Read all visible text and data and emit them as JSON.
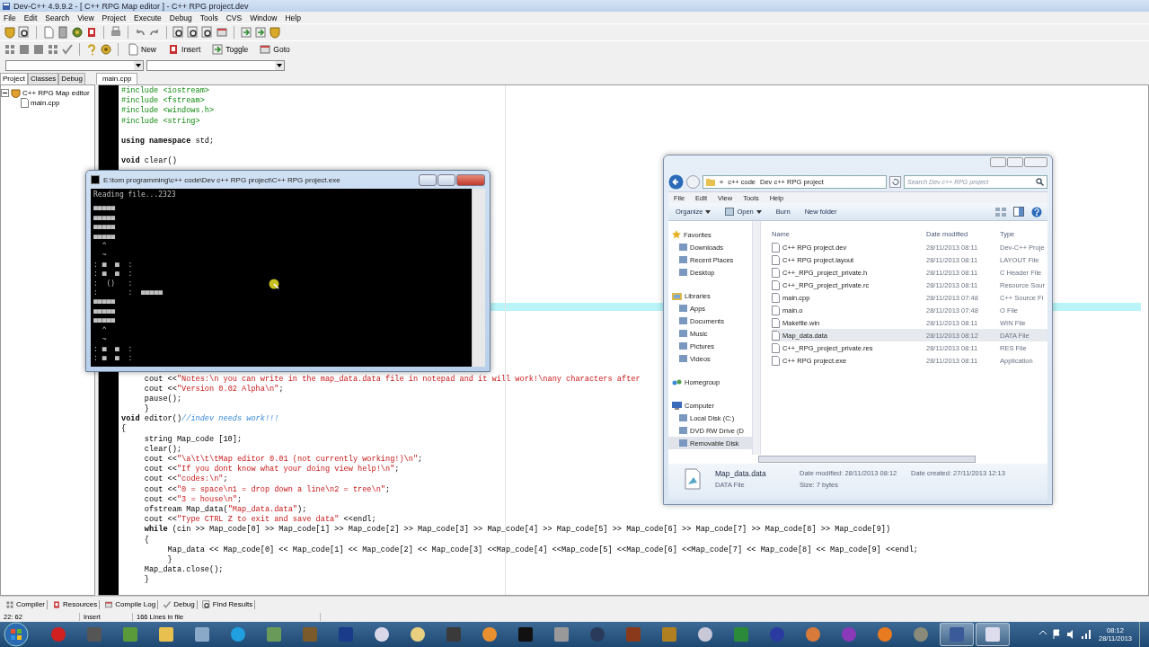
{
  "ide": {
    "title": "Dev-C++ 4.9.9.2 - [ C++ RPG Map editor ] - C++ RPG project.dev",
    "menu": [
      "File",
      "Edit",
      "Search",
      "View",
      "Project",
      "Execute",
      "Debug",
      "Tools",
      "CVS",
      "Window",
      "Help"
    ],
    "toolbar_buttons": [
      "New",
      "Insert",
      "Toggle",
      "Goto"
    ],
    "side_tabs": [
      {
        "label": "Project",
        "selected": true
      },
      {
        "label": "Classes",
        "selected": false
      },
      {
        "label": "Debug",
        "selected": false
      }
    ],
    "tree": [
      {
        "label": "C++ RPG Map editor",
        "expanded": true,
        "children": [
          {
            "label": "main.cpp"
          }
        ]
      }
    ],
    "editor_tabs": [
      {
        "label": "main.cpp",
        "selected": true
      }
    ],
    "code_top": [
      {
        "kind": "code",
        "segments": [
          {
            "kind": "preproc",
            "text": "#include <iostream>"
          }
        ]
      },
      {
        "kind": "code",
        "segments": [
          {
            "kind": "preproc",
            "text": "#include <fstream>"
          }
        ]
      },
      {
        "kind": "code",
        "segments": [
          {
            "kind": "preproc",
            "text": "#include <windows.h>"
          }
        ]
      },
      {
        "kind": "code",
        "segments": [
          {
            "kind": "preproc",
            "text": "#include <string>"
          }
        ]
      },
      {
        "kind": "blank"
      },
      {
        "kind": "code",
        "segments": [
          {
            "kind": "keyword",
            "text": "using namespace"
          },
          {
            "kind": "plain",
            "text": " std;"
          }
        ]
      },
      {
        "kind": "blank"
      },
      {
        "kind": "code",
        "segments": [
          {
            "kind": "keyword",
            "text": "void"
          },
          {
            "kind": "plain",
            "text": " clear()"
          }
        ]
      }
    ],
    "code_bottom": [
      {
        "kind": "code",
        "segments": [
          {
            "kind": "plain",
            "text": "\tcout <<"
          },
          {
            "kind": "string",
            "text": "\"Notes:\\n you can write in the map_data.data file in notepad and it will work!\\nany characters after"
          }
        ]
      },
      {
        "kind": "code",
        "segments": [
          {
            "kind": "plain",
            "text": "\tcout <<"
          },
          {
            "kind": "string",
            "text": "\"Version 0.02 Alpha\\n\""
          },
          {
            "kind": "plain",
            "text": ";"
          }
        ]
      },
      {
        "kind": "code",
        "segments": [
          {
            "kind": "plain",
            "text": "\tpause();"
          }
        ]
      },
      {
        "kind": "code",
        "segments": [
          {
            "kind": "plain",
            "text": "\t}"
          }
        ]
      },
      {
        "kind": "code",
        "segments": [
          {
            "kind": "keyword",
            "text": "void"
          },
          {
            "kind": "plain",
            "text": " editor()"
          },
          {
            "kind": "comment",
            "text": "//indev needs work!!!"
          }
        ]
      },
      {
        "kind": "code",
        "segments": [
          {
            "kind": "plain",
            "text": "{"
          }
        ]
      },
      {
        "kind": "code",
        "segments": [
          {
            "kind": "plain",
            "text": "\tstring Map_code [10];"
          }
        ]
      },
      {
        "kind": "code",
        "segments": [
          {
            "kind": "plain",
            "text": "\tclear();"
          }
        ]
      },
      {
        "kind": "code",
        "segments": [
          {
            "kind": "plain",
            "text": "\tcout <<"
          },
          {
            "kind": "string",
            "text": "\"\\a\\t\\t\\tMap editor 0.01 (not currently working!)\\n\""
          },
          {
            "kind": "plain",
            "text": ";"
          }
        ]
      },
      {
        "kind": "code",
        "segments": [
          {
            "kind": "plain",
            "text": "\tcout <<"
          },
          {
            "kind": "string",
            "text": "\"If you dont know what your doing view help!\\n\""
          },
          {
            "kind": "plain",
            "text": ";"
          }
        ]
      },
      {
        "kind": "code",
        "segments": [
          {
            "kind": "plain",
            "text": "\tcout <<"
          },
          {
            "kind": "string",
            "text": "\"codes:\\n\""
          },
          {
            "kind": "plain",
            "text": ";"
          }
        ]
      },
      {
        "kind": "code",
        "segments": [
          {
            "kind": "plain",
            "text": "\tcout <<"
          },
          {
            "kind": "string",
            "text": "\"0 = space\\n1 = drop down a line\\n2 = tree\\n\""
          },
          {
            "kind": "plain",
            "text": ";"
          }
        ]
      },
      {
        "kind": "code",
        "segments": [
          {
            "kind": "plain",
            "text": "\tcout <<"
          },
          {
            "kind": "string",
            "text": "\"3 = house\\n\""
          },
          {
            "kind": "plain",
            "text": ";"
          }
        ]
      },
      {
        "kind": "code",
        "segments": [
          {
            "kind": "plain",
            "text": "\tofstream Map_data("
          },
          {
            "kind": "string",
            "text": "\"Map_data.data\""
          },
          {
            "kind": "plain",
            "text": ");"
          }
        ]
      },
      {
        "kind": "code",
        "segments": [
          {
            "kind": "plain",
            "text": "\tcout <<"
          },
          {
            "kind": "string",
            "text": "\"Type CTRL Z to exit and save data\""
          },
          {
            "kind": "plain",
            "text": " <<endl;"
          }
        ]
      },
      {
        "kind": "code",
        "segments": [
          {
            "kind": "keyword",
            "text": "\twhile"
          },
          {
            "kind": "plain",
            "text": " (cin >> Map_code[0] >> Map_code[1] >> Map_code[2] >> Map_code[3] >> Map_code[4] >> Map_code[5] >> Map_code[6] >> Map_code[7] >> Map_code[8] >> Map_code[9])"
          }
        ]
      },
      {
        "kind": "code",
        "segments": [
          {
            "kind": "plain",
            "text": "\t{"
          }
        ]
      },
      {
        "kind": "code",
        "segments": [
          {
            "kind": "plain",
            "text": "\t\tMap_data << Map_code[0] << Map_code[1] << Map_code[2] << Map_code[3] <<Map_code[4] <<Map_code[5] <<Map_code[6] <<Map_code[7] << Map_code[8] << Map_code[9] <<endl;"
          }
        ]
      },
      {
        "kind": "code",
        "segments": [
          {
            "kind": "plain",
            "text": "\t\t}"
          }
        ]
      },
      {
        "kind": "code",
        "segments": [
          {
            "kind": "plain",
            "text": "\tMap_data.close();"
          }
        ]
      },
      {
        "kind": "code",
        "segments": [
          {
            "kind": "plain",
            "text": "\t}"
          }
        ]
      }
    ],
    "bottom_tabs": [
      "Compiler",
      "Resources",
      "Compile Log",
      "Debug",
      "Find Results"
    ],
    "status": [
      "22: 62",
      "Insert",
      "166 Lines in file"
    ]
  },
  "console": {
    "title": "E:\\tom programming\\c++ code\\Dev c++ RPG project\\C++ RPG project.exe",
    "lines": [
      "Reading file...2323",
      "■■■■■",
      "■■■■■",
      "■■■■■",
      "■■■■■",
      "  ^",
      "  ~",
      ": ■  ■  :",
      ": ■  ■  :",
      ":  ()   :",
      ":       :  ■■■■■",
      "■■■■■",
      "■■■■■",
      "■■■■■",
      "  ^",
      "  ~",
      ": ■  ■  :",
      ": ■  ■  :"
    ]
  },
  "explorer": {
    "breadcrumb": [
      "«",
      "c++ code",
      "Dev c++ RPG project"
    ],
    "search": {
      "placeholder": "Search Dev c++ RPG project"
    },
    "menu": [
      "File",
      "Edit",
      "View",
      "Tools",
      "Help"
    ],
    "commands": [
      {
        "label": "Organize",
        "dropdown": true
      },
      {
        "label": "Open",
        "dropdown": true
      },
      {
        "label": "Burn",
        "dropdown": false
      },
      {
        "label": "New folder",
        "dropdown": false
      }
    ],
    "nav": [
      {
        "kind": "header",
        "label": "Favorites",
        "selected": false
      },
      {
        "kind": "item",
        "label": "Downloads",
        "selected": false
      },
      {
        "kind": "item",
        "label": "Recent Places",
        "selected": false
      },
      {
        "kind": "item",
        "label": "Desktop",
        "selected": false
      },
      {
        "kind": "header",
        "label": "Libraries",
        "selected": false
      },
      {
        "kind": "item",
        "label": "Apps",
        "selected": false
      },
      {
        "kind": "item",
        "label": "Documents",
        "selected": false
      },
      {
        "kind": "item",
        "label": "Music",
        "selected": false
      },
      {
        "kind": "item",
        "label": "Pictures",
        "selected": false
      },
      {
        "kind": "item",
        "label": "Videos",
        "selected": false
      },
      {
        "kind": "header",
        "label": "Homegroup",
        "selected": false
      },
      {
        "kind": "header",
        "label": "Computer",
        "selected": false
      },
      {
        "kind": "item",
        "label": "Local Disk (C:)",
        "selected": false
      },
      {
        "kind": "item",
        "label": "DVD RW Drive (D",
        "selected": false
      },
      {
        "kind": "item",
        "label": "Removable Disk",
        "selected": true
      }
    ],
    "columns": [
      "Name",
      "Date modified",
      "Type"
    ],
    "files": [
      {
        "name": "C++ RPG project.dev",
        "date": "28/11/2013 08:11",
        "type": "Dev-C++ Proje",
        "selected": false
      },
      {
        "name": "C++ RPG project.layout",
        "date": "28/11/2013 08:11",
        "type": "LAYOUT File",
        "selected": false
      },
      {
        "name": "C++_RPG_project_private.h",
        "date": "28/11/2013 08:11",
        "type": "C Header File",
        "selected": false
      },
      {
        "name": "C++_RPG_project_private.rc",
        "date": "28/11/2013 08:11",
        "type": "Resource Sour",
        "selected": false
      },
      {
        "name": "main.cpp",
        "date": "28/11/2013 07:48",
        "type": "C++ Source Fi",
        "selected": false
      },
      {
        "name": "main.o",
        "date": "28/11/2013 07:48",
        "type": "O File",
        "selected": false
      },
      {
        "name": "Makefile.win",
        "date": "28/11/2013 08:11",
        "type": "WIN File",
        "selected": false
      },
      {
        "name": "Map_data.data",
        "date": "28/11/2013 08:12",
        "type": "DATA File",
        "selected": true
      },
      {
        "name": "C++_RPG_project_private.res",
        "date": "28/11/2013 08:11",
        "type": "RES File",
        "selected": false
      },
      {
        "name": "C++ RPG project.exe",
        "date": "28/11/2013 08:11",
        "type": "Application",
        "selected": false
      }
    ],
    "details": {
      "name": "Map_data.data",
      "type": "DATA File",
      "fields": [
        {
          "label": "Date modified:",
          "value": "28/11/2013 08:12"
        },
        {
          "label": "Date created:",
          "value": "27/11/2013 12:13"
        },
        {
          "label": "Size:",
          "value": "7 bytes"
        }
      ]
    }
  },
  "taskbar": {
    "time": "08:12",
    "date": "28/11/2013"
  }
}
